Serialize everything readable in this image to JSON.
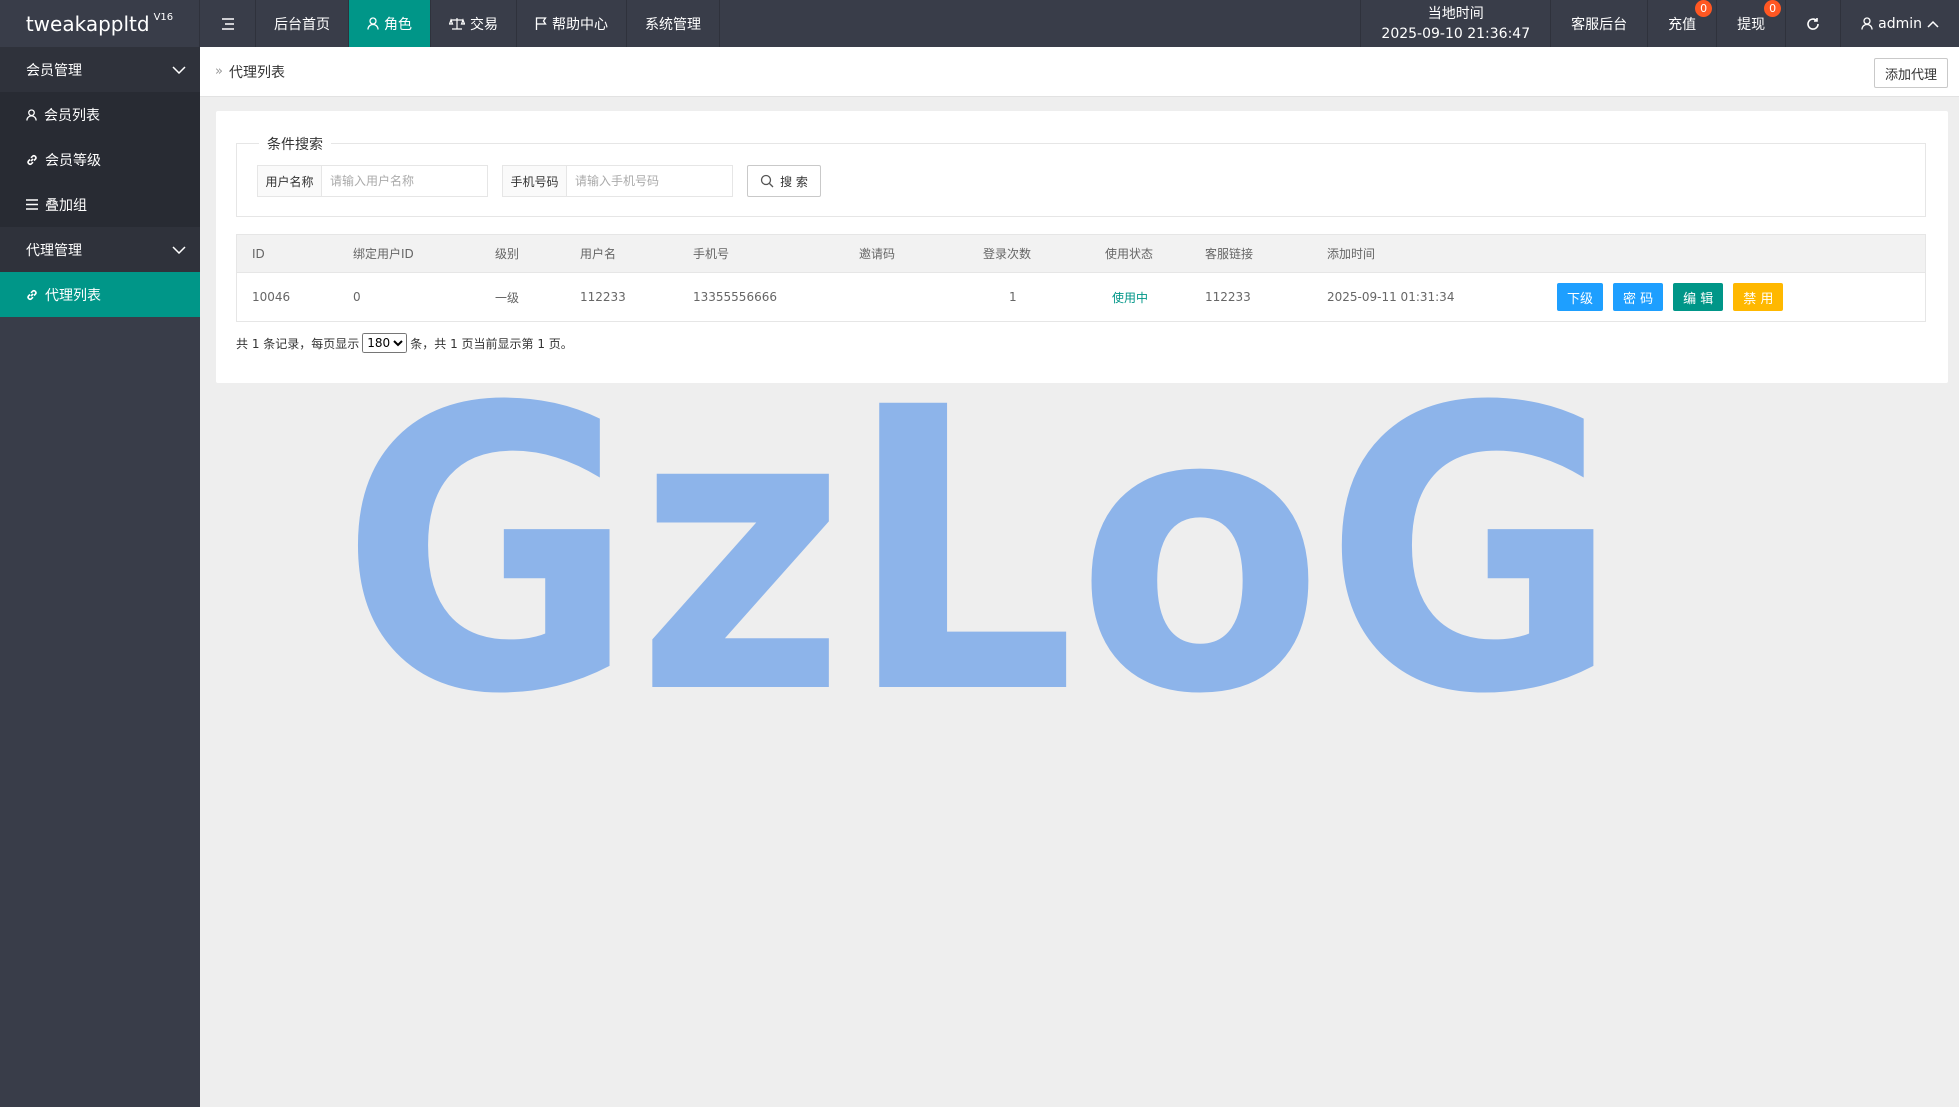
{
  "app": {
    "title": "tweakappltd",
    "version": "V16"
  },
  "topnav": {
    "items": [
      {
        "label": "后台首页",
        "icon": "none"
      },
      {
        "label": "角色",
        "icon": "user-icon"
      },
      {
        "label": "交易",
        "icon": "scale-icon"
      },
      {
        "label": "帮助中心",
        "icon": "flag-icon"
      },
      {
        "label": "系统管理",
        "icon": "none"
      }
    ],
    "active": "角色",
    "time_label": "当地时间",
    "time_value": "2025-09-10 21:36:47",
    "service": "客服后台",
    "recharge": "充值",
    "recharge_badge": "0",
    "withdraw": "提现",
    "withdraw_badge": "0",
    "user": "admin",
    "accent": "#009688",
    "badge_color": "#ff5722"
  },
  "sidebar": {
    "groups": [
      {
        "label": "会员管理",
        "items": [
          {
            "label": "会员列表",
            "icon": "user-icon"
          },
          {
            "label": "会员等级",
            "icon": "link-icon"
          },
          {
            "label": "叠加组",
            "icon": "list-icon"
          }
        ]
      },
      {
        "label": "代理管理",
        "items": [
          {
            "label": "代理列表",
            "icon": "link-icon",
            "active": true
          }
        ]
      }
    ]
  },
  "breadcrumb": {
    "current": "代理列表"
  },
  "toolbar": {
    "add_label": "添加代理"
  },
  "search": {
    "legend": "条件搜索",
    "username_label": "用户名称",
    "username_placeholder": "请输入用户名称",
    "phone_label": "手机号码",
    "phone_placeholder": "请输入手机号码",
    "button": "搜 索"
  },
  "table": {
    "columns": [
      "ID",
      "绑定用户ID",
      "级别",
      "用户名",
      "手机号",
      "邀请码",
      "登录次数",
      "使用状态",
      "客服链接",
      "添加时间"
    ],
    "rows": [
      {
        "id": "10046",
        "bind_user_id": "0",
        "level": "一级",
        "username": "112233",
        "phone": "13355556666",
        "invite_code": "",
        "login_count": "1",
        "status": "使用中",
        "service_link": "112233",
        "added": "2025-09-11 01:31:34"
      }
    ],
    "actions": [
      {
        "label": "下级",
        "color": "#1e9fff"
      },
      {
        "label": "密 码",
        "color": "#1e9fff"
      },
      {
        "label": "编 辑",
        "color": "#009688"
      },
      {
        "label": "禁 用",
        "color": "#ffb800"
      }
    ]
  },
  "pager": {
    "prefix": "共 1 条记录，每页显示",
    "page_size": "180",
    "suffix": "条，共 1 页当前显示第 1 页。"
  },
  "watermark": {
    "text": "GzLoG",
    "color": "#8db4ea"
  }
}
